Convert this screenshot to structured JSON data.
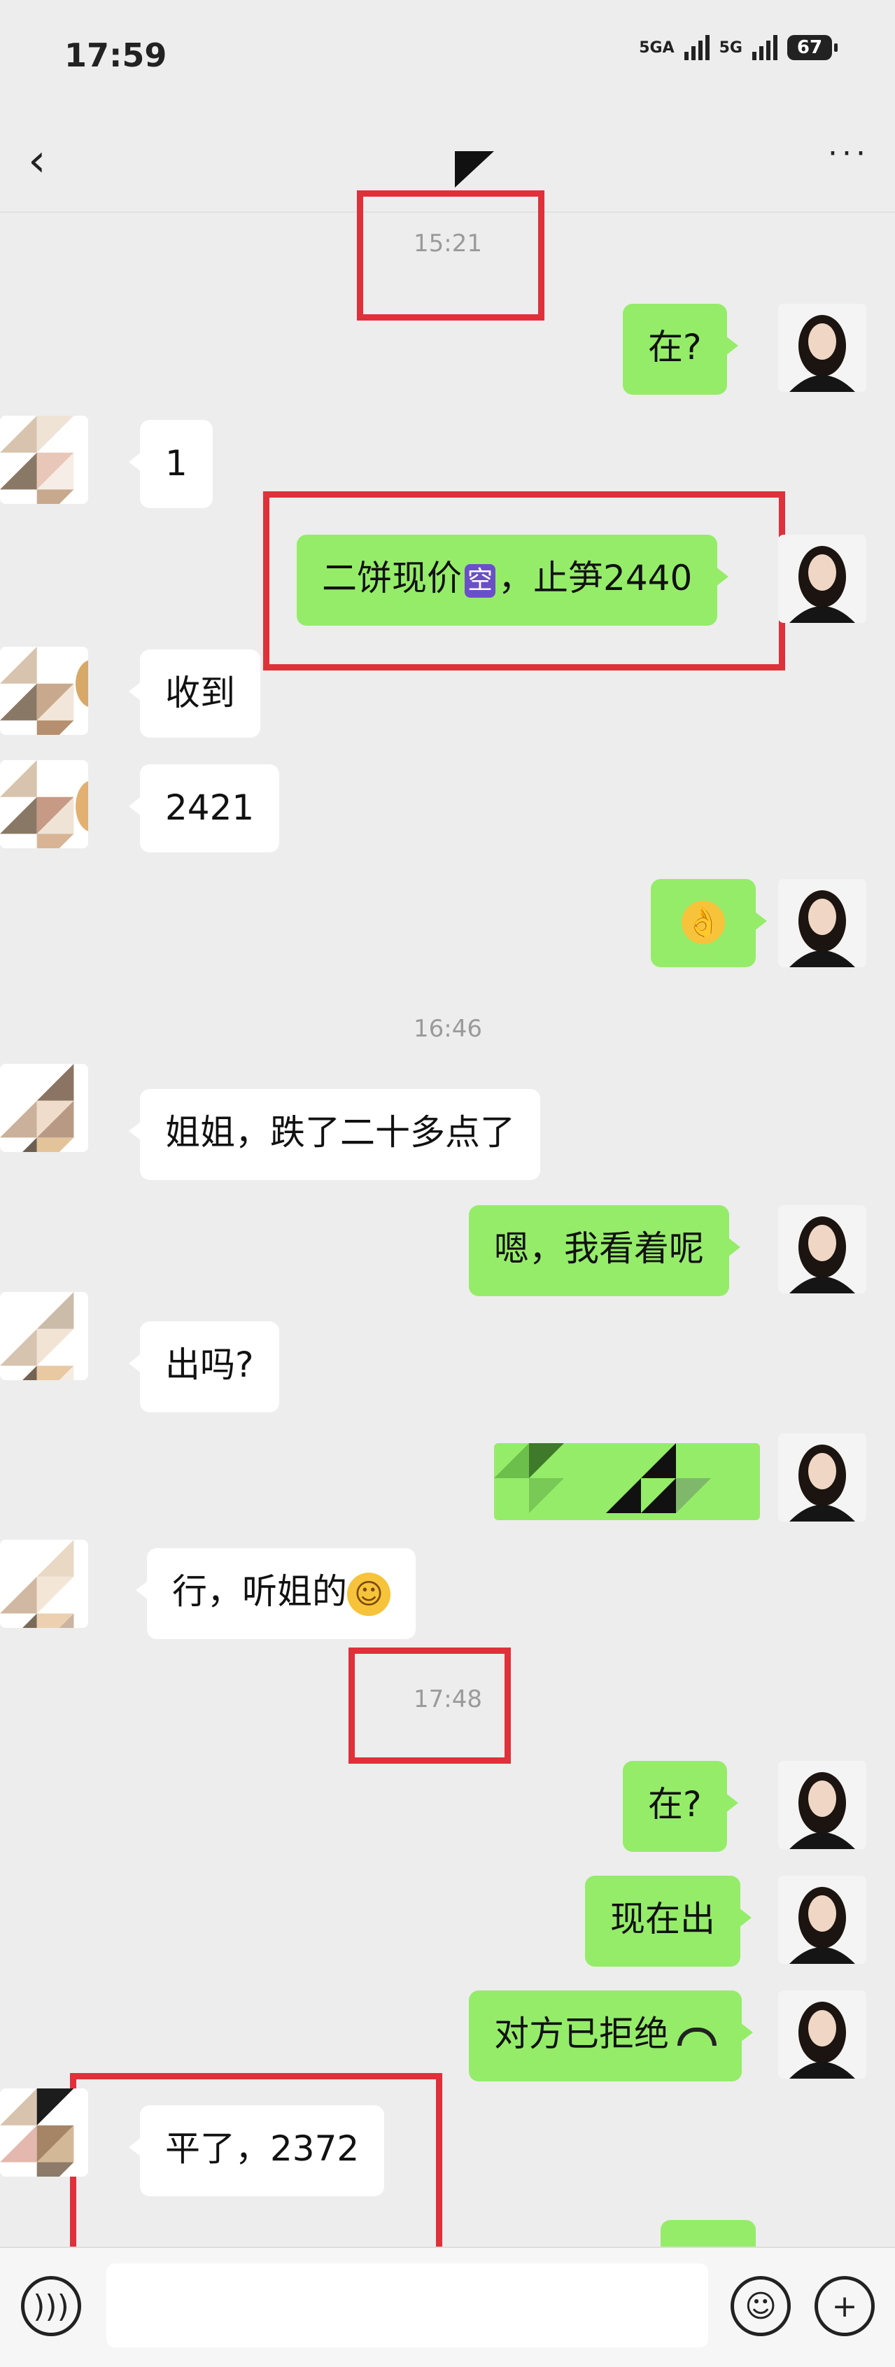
{
  "status_bar": {
    "time": "17:59",
    "network1": "5GA",
    "network2": "5G",
    "battery": "67"
  },
  "nav": {
    "back_icon": "chevron-left-icon",
    "more_icon": "more-dots-icon"
  },
  "timestamps": [
    "15:21",
    "16:46",
    "17:48"
  ],
  "messages": [
    {
      "side": "me",
      "text": "在?"
    },
    {
      "side": "them",
      "text": "1"
    },
    {
      "side": "me",
      "text_before": "二饼现价",
      "badge": "空",
      "text_after": "，止笋2440"
    },
    {
      "side": "them",
      "text": "收到"
    },
    {
      "side": "them",
      "text": "2421"
    },
    {
      "side": "me",
      "emoji": "ok-hand-icon",
      "glyph": "👌"
    },
    {
      "side": "them",
      "text": "姐姐，跌了二十多点了"
    },
    {
      "side": "me",
      "text": "嗯，我看着呢"
    },
    {
      "side": "them",
      "text": "出吗?"
    },
    {
      "side": "me",
      "redacted": true
    },
    {
      "side": "them",
      "text": "行，听姐的",
      "emoji_glyph": "☺"
    },
    {
      "side": "me",
      "text": "在?"
    },
    {
      "side": "me",
      "text": "现在出"
    },
    {
      "side": "me",
      "text": "对方已拒绝"
    },
    {
      "side": "them",
      "text": "平了，2372"
    }
  ],
  "input": {
    "voice_icon": "voice-icon",
    "emoji_icon": "emoji-face-icon",
    "plus_icon": "plus-icon"
  },
  "colors": {
    "background": "#ededed",
    "my_bubble": "#95ec69",
    "their_bubble": "#ffffff",
    "highlight": "#e0303a"
  }
}
